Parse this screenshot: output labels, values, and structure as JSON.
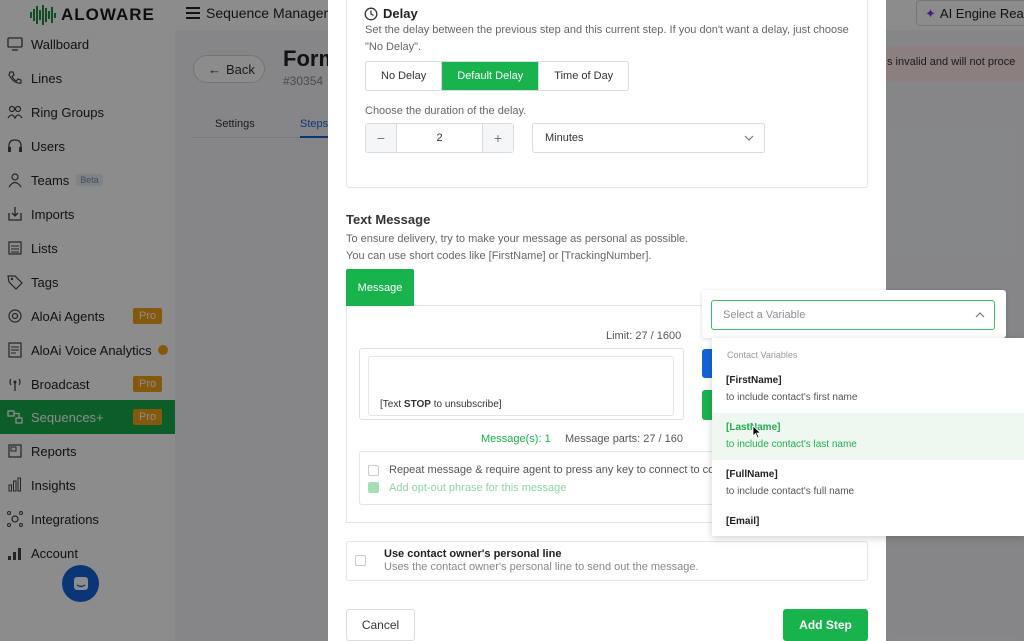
{
  "app": {
    "logo_text": "ALOWARE",
    "title": "Sequence Manager",
    "ai_badge": "AI Engine Read"
  },
  "sidebar": {
    "items": [
      {
        "label": "Wallboard",
        "icon": "monitor-icon"
      },
      {
        "label": "Lines",
        "icon": "phone-icon"
      },
      {
        "label": "Ring Groups",
        "icon": "ring-groups-icon"
      },
      {
        "label": "Users",
        "icon": "headset-icon"
      },
      {
        "label": "Teams",
        "icon": "team-icon",
        "badge": "Beta"
      },
      {
        "label": "Imports",
        "icon": "import-icon"
      },
      {
        "label": "Lists",
        "icon": "list-icon"
      },
      {
        "label": "Tags",
        "icon": "tag-icon"
      },
      {
        "label": "AloAi Agents",
        "icon": "robot-icon",
        "badge": "Pro"
      },
      {
        "label": "AloAi Voice Analytics",
        "icon": "analytics-icon"
      },
      {
        "label": "Broadcast",
        "icon": "broadcast-icon",
        "badge": "Pro"
      },
      {
        "label": "Sequences+",
        "icon": "sequences-icon",
        "badge": "Pro",
        "active": true
      },
      {
        "label": "Reports",
        "icon": "reports-icon"
      },
      {
        "label": "Insights",
        "icon": "insights-icon"
      },
      {
        "label": "Integrations",
        "icon": "integrations-icon"
      },
      {
        "label": "Account",
        "icon": "account-icon"
      }
    ]
  },
  "background": {
    "back_label": "Back",
    "title": "Form",
    "subtitle": "#30354",
    "tab_settings": "Settings",
    "tab_steps": "Steps",
    "alert_text": "s invalid and will not proce"
  },
  "delay": {
    "heading": "Delay",
    "help_line1": "Set the delay between the previous step and this current step. If you don't want a delay, just choose",
    "help_line2": "\"No Delay\".",
    "options": [
      "No Delay",
      "Default Delay",
      "Time of Day"
    ],
    "selected": "Default Delay",
    "duration_label": "Choose the duration of the delay.",
    "duration_value": "2",
    "unit_value": "Minutes"
  },
  "text_message": {
    "title": "Text Message",
    "help_line1": "To ensure delivery, try to make your message as personal as possible.",
    "help_line2": "You can use short codes like [FirstName] or [TrackingNumber].",
    "tab_label": "Message",
    "limit": "Limit: 27 / 1600",
    "stop_prefix": "[Text ",
    "stop_word": "STOP",
    "stop_suffix": " to unsubscribe]",
    "messages_count": "Message(s): 1",
    "message_parts": "Message parts: 27 / 160",
    "option_repeat": "Repeat message & require agent to press any key to connect to cont",
    "option_optout": "Add opt-out phrase for this message"
  },
  "owner_line": {
    "title": "Use contact owner's personal line",
    "description": "Uses the contact owner's personal line to send out the message."
  },
  "footer": {
    "cancel": "Cancel",
    "add_step": "Add Step"
  },
  "variable_picker": {
    "placeholder": "Select a Variable",
    "group_label": "Contact Variables",
    "options": [
      {
        "name": "[FirstName]",
        "desc": "to include contact's first name"
      },
      {
        "name": "[LastName]",
        "desc": "to include contact's last name"
      },
      {
        "name": "[FullName]",
        "desc": "to include contact's full name"
      },
      {
        "name": "[Email]",
        "desc": ""
      }
    ],
    "highlighted": "[LastName]"
  },
  "colors": {
    "brand_green": "#19b34e",
    "active_nav": "#19a94b",
    "pro_badge": "#f0a21a",
    "primary_blue": "#1463d8"
  }
}
